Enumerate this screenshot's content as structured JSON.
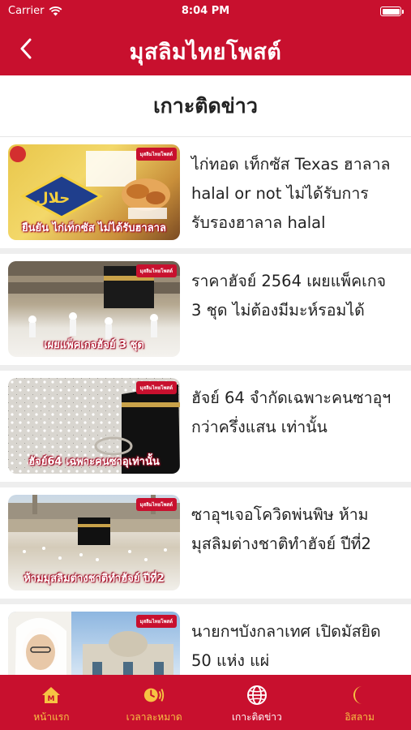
{
  "status_bar": {
    "carrier": "Carrier",
    "time": "8:04 PM"
  },
  "header": {
    "brand": "มุสลิมไทยโพสต์"
  },
  "page": {
    "title": "เกาะติดข่าว"
  },
  "news": [
    {
      "headline": "ไก่ทอด เท็กซัส Texas ฮาลาล halal or not ไม่ได้รับการรับรองฮาลาล halal",
      "caption": "ยืนยัน ไก่เท็กซัส ไม่ได้รับฮาลาล",
      "badge": "มุสลิมไทยโพสต์"
    },
    {
      "headline": "ราคาฮัจย์ 2564 เผยแพ็คเกจ 3 ชุด ไม่ต้องมีมะห์รอมได้",
      "caption": "เผยแพ็คเกจฮัจย์ 3 ชุด",
      "badge": "มุสลิมไทยโพสต์"
    },
    {
      "headline": "ฮัจย์ 64 จำกัดเฉพาะคนซาอุฯ กว่าครึ่งแสน เท่านั้น",
      "caption": "ฮัจย์64 เฉพาะคนซาอุเท่านั้น",
      "badge": "มุสลิมไทยโพสต์"
    },
    {
      "headline": "ซาอุฯเจอโควิดพ่นพิษ ห้ามมุสลิมต่างชาติทำฮัจย์ ปีที่2",
      "caption": "ห้ามมุสลิมต่างชาติทำฮัจย์ ปีที่2",
      "badge": "มุสลิมไทยโพสต์"
    },
    {
      "headline": "นายกฯบังกลาเทศ เปิดมัสยิด 50 แห่ง แผ่",
      "caption": "",
      "badge": "มุสลิมไทยโพสต์"
    }
  ],
  "tabs": [
    {
      "label": "หน้าแรก",
      "icon": "home-icon"
    },
    {
      "label": "เวลาละหมาด",
      "icon": "prayer-time-icon"
    },
    {
      "label": "เกาะติดข่าว",
      "icon": "globe-icon"
    },
    {
      "label": "อิสลาม",
      "icon": "crescent-moon-icon"
    }
  ],
  "colors": {
    "brand_red": "#c8102e",
    "tab_inactive": "#f6c343",
    "tab_active": "#ffffff"
  }
}
